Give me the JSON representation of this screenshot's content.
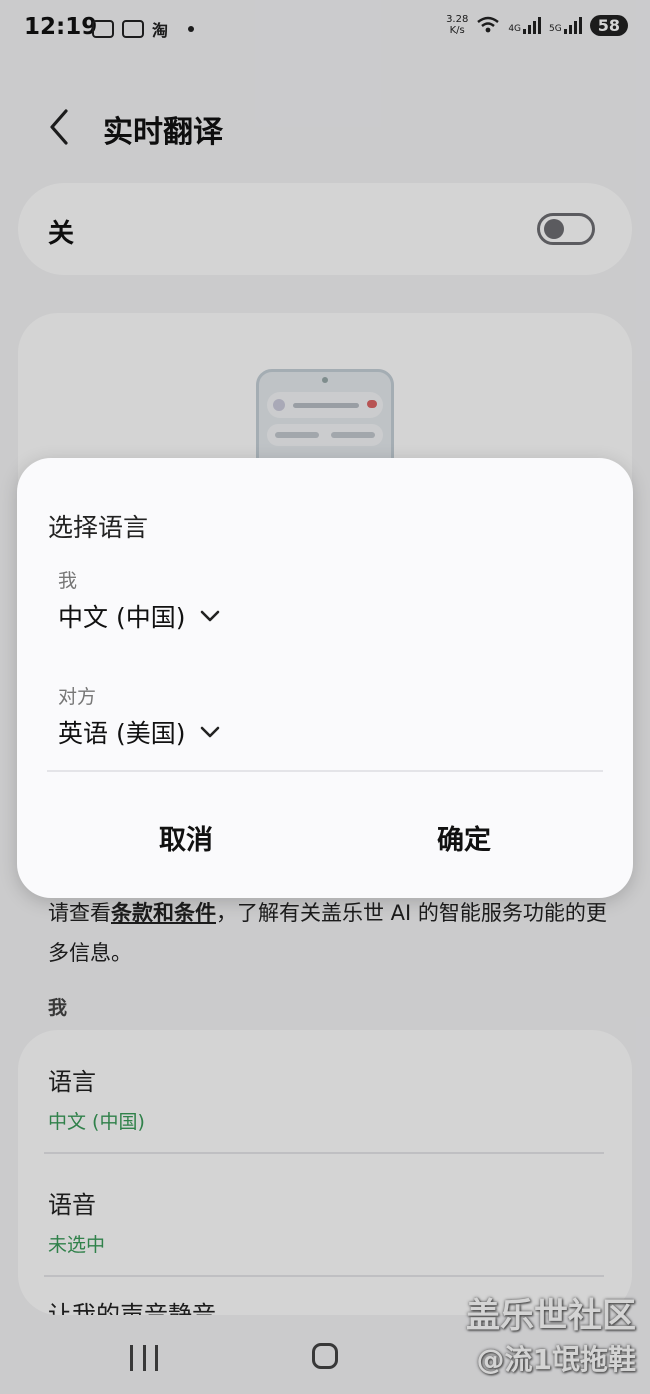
{
  "status_bar": {
    "time": "12:19",
    "net_speed_value": "3.28",
    "net_speed_unit": "K/s",
    "signal_1": "4G",
    "signal_2": "5G",
    "battery": "58",
    "app_icon_text": "淘"
  },
  "header": {
    "title": "实时翻译"
  },
  "toggle": {
    "label": "关",
    "state": "off"
  },
  "terms": {
    "prefix": "请查看",
    "link": "条款和条件",
    "suffix": "，了解有关盖乐世 AI 的智能服务功能的更多信息。"
  },
  "section_me": "我",
  "settings": {
    "language_title": "语言",
    "language_value": "中文 (中国)",
    "voice_title": "语音",
    "voice_value": "未选中",
    "partial_next": "让我的声音静音"
  },
  "dialog": {
    "title": "选择语言",
    "me_label": "我",
    "me_value": "中文 (中国)",
    "other_label": "对方",
    "other_value": "英语 (美国)",
    "cancel": "取消",
    "ok": "确定"
  },
  "watermark": {
    "line1": "盖乐世社区",
    "line2": "@流1氓拖鞋"
  },
  "colors": {
    "accent_green": "#3a9c5a",
    "background": "#f4f4f6"
  }
}
